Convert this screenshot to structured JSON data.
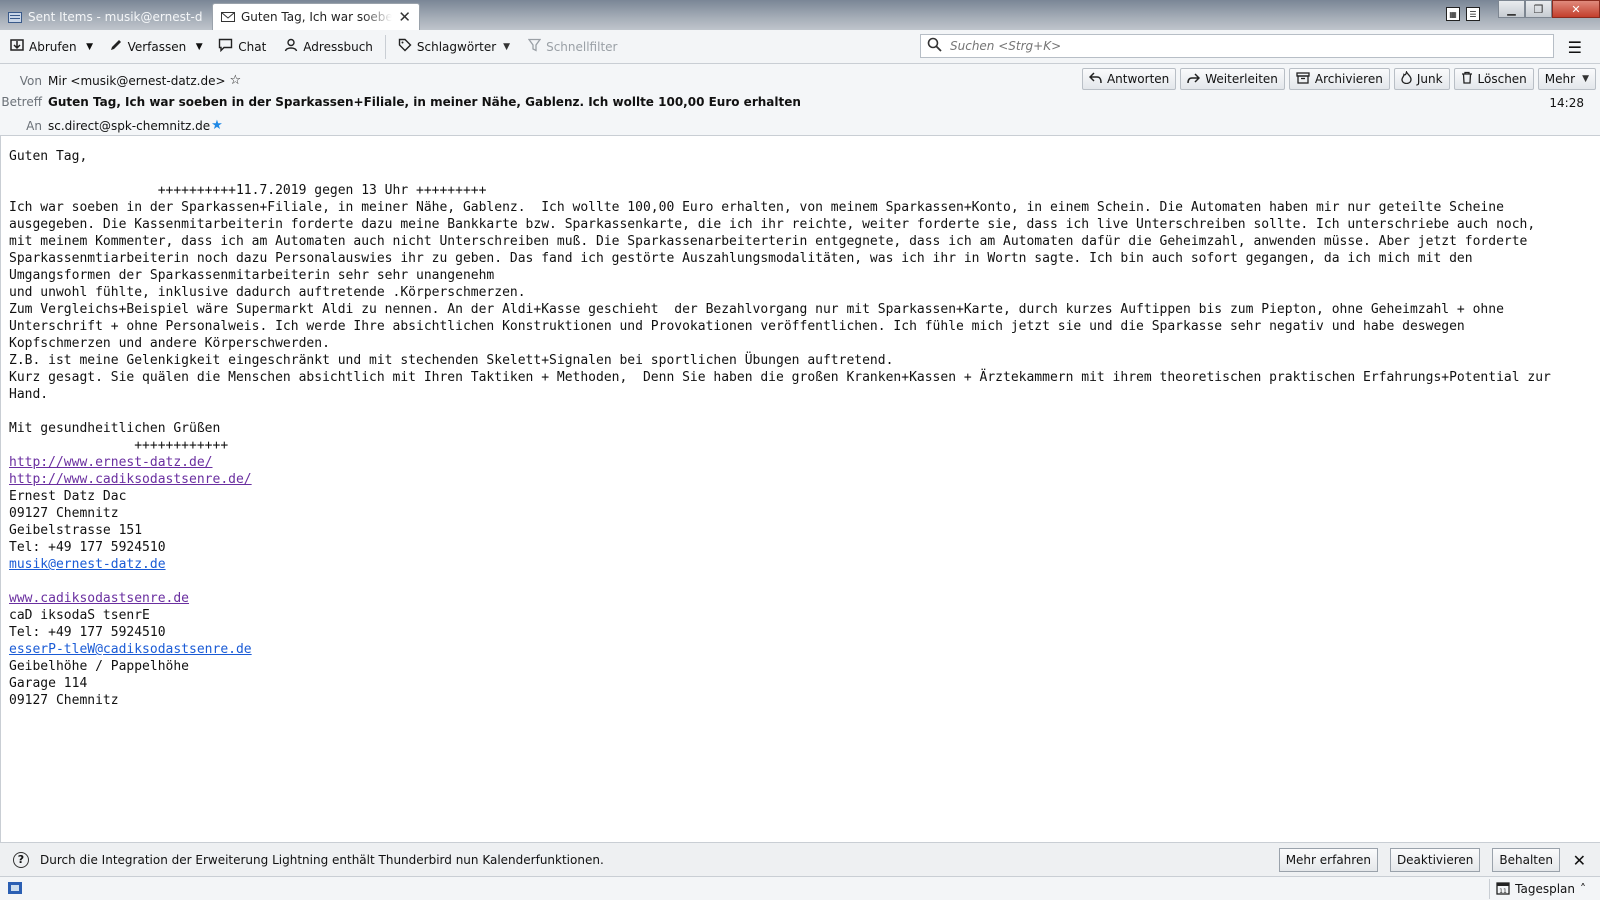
{
  "tabs": [
    {
      "title": "Sent Items - musik@ernest-datz.de",
      "icon": "folder-icon"
    },
    {
      "title": "Guten Tag, Ich war soeben in der Sparkassen+Filiale",
      "icon": "envelope-icon",
      "close": "✕"
    }
  ],
  "toolbar": {
    "get_messages": "Abrufen",
    "write": "Verfassen",
    "chat": "Chat",
    "address_book": "Adressbuch",
    "tags": "Schlagwörter",
    "quick_filter": "Schnellfilter",
    "search_placeholder": "Suchen <Strg+K>"
  },
  "header": {
    "from_label": "Von",
    "from_value": "Mir <musik@ernest-datz.de>",
    "subject_label": "Betreff",
    "subject_value": "Guten Tag, Ich war soeben in der Sparkassen+Filiale, in meiner Nähe, Gablenz. Ich wollte 100,00 Euro erhalten",
    "to_label": "An",
    "to_value": "sc.direct@spk-chemnitz.de",
    "time": "14:28",
    "actions": {
      "reply": "Antworten",
      "forward": "Weiterleiten",
      "archive": "Archivieren",
      "junk": "Junk",
      "delete": "Löschen",
      "more": "Mehr"
    }
  },
  "body": {
    "text": "Guten Tag,\n\n                   ++++++++++11.7.2019 gegen 13 Uhr +++++++++\nIch war soeben in der Sparkassen+Filiale, in meiner Nähe, Gablenz.  Ich wollte 100,00 Euro erhalten, von meinem Sparkassen+Konto, in einem Schein. Die Automaten haben mir nur geteilte Scheine\nausgegeben. Die Kassenmitarbeiterin forderte dazu meine Bankkarte bzw. Sparkassenkarte, die ich ihr reichte, weiter forderte sie, dass ich live Unterschreiben sollte. Ich unterschriebe auch noch,\nmit meinem Kommenter, dass ich am Automaten auch nicht Unterschreiben muß. Die Sparkassenarbeiterterin entgegnete, dass ich am Automaten dafür die Geheimzahl, anwenden müsse. Aber jetzt forderte\nSparkassenmtiarbeiterin noch dazu Personalauswies ihr zu geben. Das fand ich gestörte Auszahlungsmodalitäten, was ich ihr in Wortn sagte. Ich bin auch sofort gegangen, da ich mich mit den\nUmgangsformen der Sparkassenmitarbeiterin sehr sehr unangenehm\nund unwohl fühlte, inklusive dadurch auftretende .Körperschmerzen.\nZum Vergleichs+Beispiel wäre Supermarkt Aldi zu nennen. An der Aldi+Kasse geschieht  der Bezahlvorgang nur mit Sparkassen+Karte, durch kurzes Auftippen bis zum Piepton, ohne Geheimzahl + ohne\nUnterschrift + ohne Personalweis. Ich werde Ihre absichtlichen Konstruktionen und Provokationen veröffentlichen. Ich fühle mich jetzt sie und die Sparkasse sehr negativ und habe deswegen\nKopfschmerzen und andere Körperschwerden.\nZ.B. ist meine Gelenkigkeit eingeschränkt und mit stechenden Skelett+Signalen bei sportlichen Übungen auftretend.\nKurz gesagt. Sie quälen die Menschen absichtlich mit Ihren Taktiken + Methoden,  Denn Sie haben die großen Kranken+Kassen + Ärztekammern mit ihrem theoretischen praktischen Erfahrungs+Potential zur\nHand.\n\nMit gesundheitlichen Grüßen\n                ++++++++++++\n",
    "link1": "http://www.ernest-datz.de/",
    "link2": "http://www.cadiksodastsenre.de/",
    "sig1": "Ernest Datz Dac\n09127 Chemnitz\nGeibelstrasse 151\nTel: +49 177 5924510",
    "email1": "musik@ernest-datz.de",
    "link3": "www.cadiksodastsenre.de",
    "sig2": "caD iksodaS tsenrE\nTel: +49 177 5924510",
    "email2": "esserP-tleW@cadiksodastsenre.de",
    "sig3": "Geibelhöhe / Pappelhöhe\nGarage 114\n09127 Chemnitz"
  },
  "notification": {
    "message": "Durch die Integration der Erweiterung Lightning enthält Thunderbird nun Kalenderfunktionen.",
    "learn_more": "Mehr erfahren",
    "disable": "Deaktivieren",
    "keep": "Behalten"
  },
  "statusbar": {
    "today_pane": "Tagesplan"
  }
}
